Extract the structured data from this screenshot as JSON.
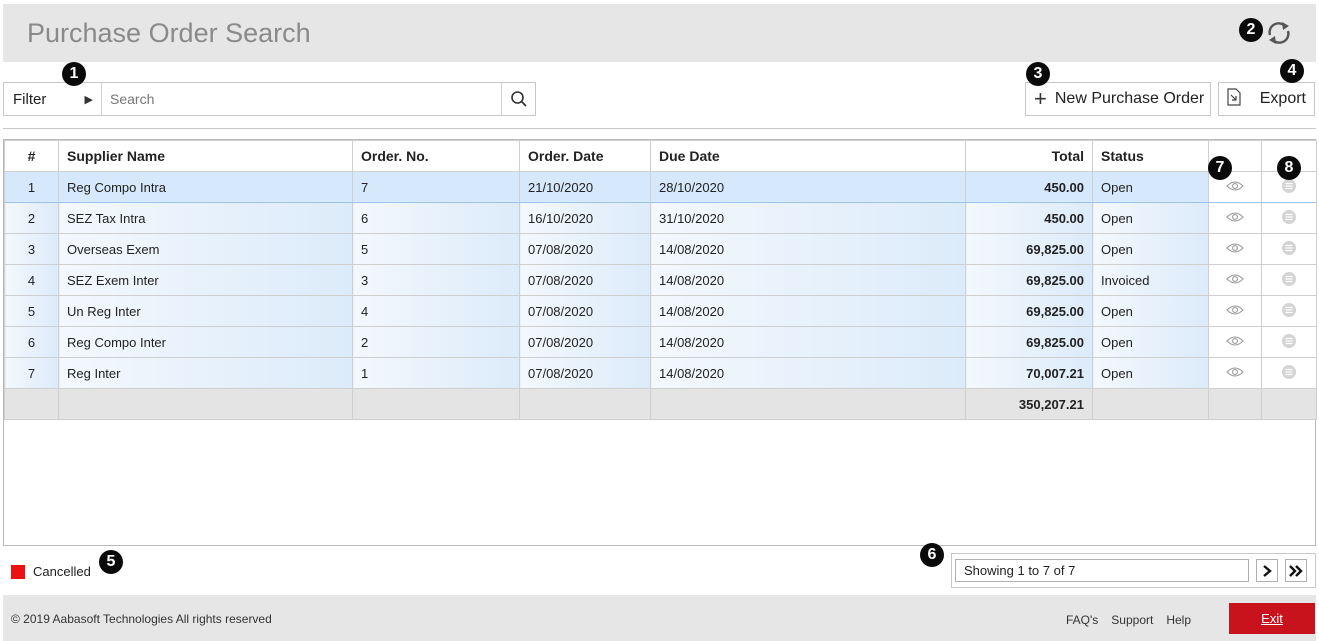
{
  "header": {
    "title": "Purchase Order Search"
  },
  "badges": [
    "1",
    "2",
    "3",
    "4",
    "5",
    "6",
    "7",
    "8"
  ],
  "toolbar": {
    "filter_label": "Filter",
    "search_placeholder": "Search",
    "new_po_label": "New Purchase Order",
    "export_label": "Export"
  },
  "table": {
    "columns": [
      "#",
      "Supplier Name",
      "Order. No.",
      "Order. Date",
      "Due Date",
      "Total",
      "Status"
    ],
    "rows": [
      {
        "num": "1",
        "supplier": "Reg Compo Intra",
        "order_no": "7",
        "order_date": "21/10/2020",
        "due_date": "28/10/2020",
        "total": "450.00",
        "status": "Open"
      },
      {
        "num": "2",
        "supplier": "SEZ Tax Intra",
        "order_no": "6",
        "order_date": "16/10/2020",
        "due_date": "31/10/2020",
        "total": "450.00",
        "status": "Open"
      },
      {
        "num": "3",
        "supplier": "Overseas Exem",
        "order_no": "5",
        "order_date": "07/08/2020",
        "due_date": "14/08/2020",
        "total": "69,825.00",
        "status": "Open"
      },
      {
        "num": "4",
        "supplier": "SEZ Exem Inter",
        "order_no": "3",
        "order_date": "07/08/2020",
        "due_date": "14/08/2020",
        "total": "69,825.00",
        "status": "Invoiced"
      },
      {
        "num": "5",
        "supplier": "Un Reg Inter",
        "order_no": "4",
        "order_date": "07/08/2020",
        "due_date": "14/08/2020",
        "total": "69,825.00",
        "status": "Open"
      },
      {
        "num": "6",
        "supplier": "Reg Compo Inter",
        "order_no": "2",
        "order_date": "07/08/2020",
        "due_date": "14/08/2020",
        "total": "69,825.00",
        "status": "Open"
      },
      {
        "num": "7",
        "supplier": "Reg Inter",
        "order_no": "1",
        "order_date": "07/08/2020",
        "due_date": "14/08/2020",
        "total": "70,007.21",
        "status": "Open"
      }
    ],
    "grand_total": "350,207.21"
  },
  "legend": {
    "label": "Cancelled",
    "color": "#ee1111"
  },
  "pager": {
    "text": "Showing 1 to 7 of 7"
  },
  "footer": {
    "copyright": "© 2019 Aabasoft Technologies All rights reserved",
    "links": [
      "FAQ's",
      "Support",
      "Help"
    ],
    "exit_label": "Exit"
  },
  "icons": {
    "refresh": "refresh-icon",
    "filter_arrow": "play-right-icon",
    "search": "search-icon",
    "export": "export-document-icon",
    "view": "eye-icon",
    "row_menu": "menu-circle-icon",
    "next": "chevron-right-icon",
    "last": "double-chevron-right-icon"
  },
  "colors": {
    "exit": "#c8121c",
    "accent_row": "#d6e8fb"
  }
}
